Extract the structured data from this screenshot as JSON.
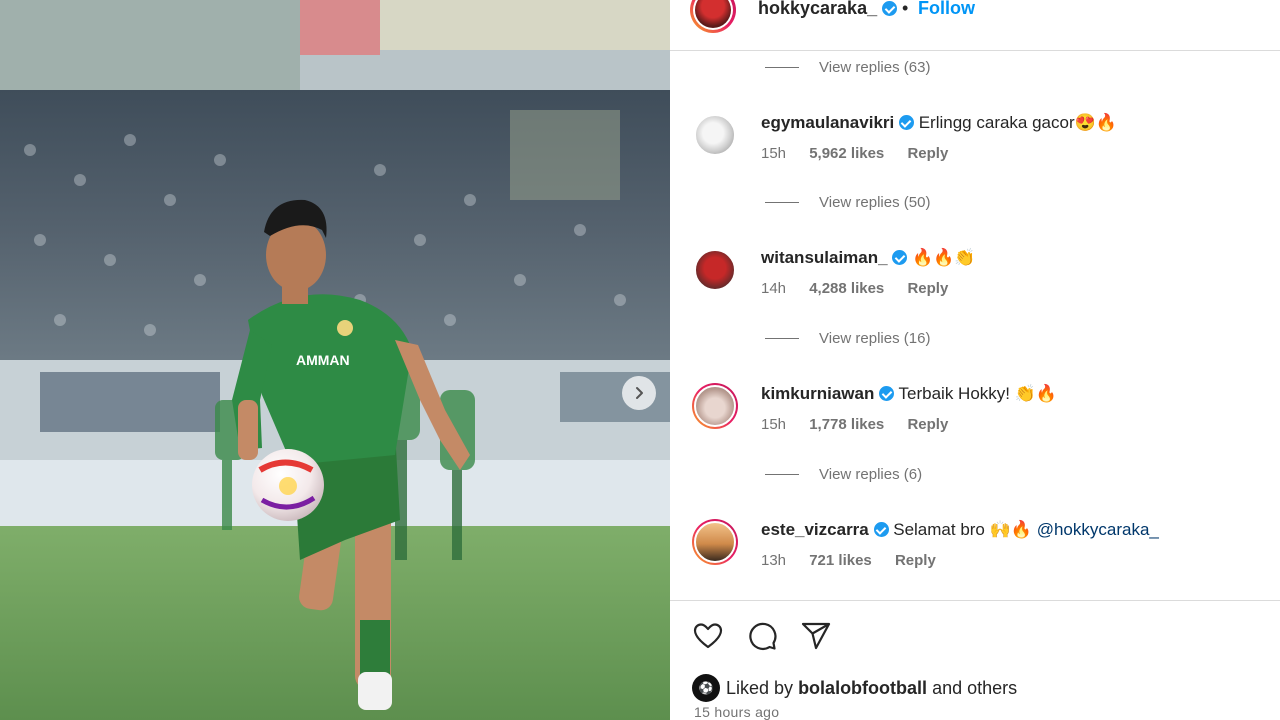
{
  "post": {
    "author": "hokkycaraka_",
    "separator": "•",
    "follow_label": "Follow",
    "liked_prefix": "Liked by",
    "liked_user": "bolalobfootball",
    "liked_suffix": "and others",
    "time_ago": "15 hours ago",
    "shirt_text": "AMMAN"
  },
  "comments": [
    {
      "view_replies_above": "View replies (63)",
      "username": "egymaulanavikri",
      "text": "Erlingg caraka gacor",
      "emojis": "😍🔥",
      "time": "15h",
      "likes": "5,962 likes",
      "reply": "Reply"
    },
    {
      "view_replies_above": "View replies (50)",
      "username": "witansulaiman_",
      "text": "",
      "emojis": "🔥🔥👏",
      "time": "14h",
      "likes": "4,288 likes",
      "reply": "Reply"
    },
    {
      "view_replies_above": "View replies (16)",
      "username": "kimkurniawan",
      "text": "Terbaik Hokky!",
      "emojis": "👏🔥",
      "time": "15h",
      "likes": "1,778 likes",
      "reply": "Reply"
    },
    {
      "view_replies_above": "View replies (6)",
      "username": "este_vizcarra",
      "text": "Selamat bro",
      "emojis": "🙌🔥",
      "mention": "@hokkycaraka_",
      "time": "13h",
      "likes": "721 likes",
      "reply": "Reply"
    }
  ],
  "icons": [
    "heart-icon",
    "comment-icon",
    "share-icon",
    "chevron-right-icon",
    "verified-icon"
  ],
  "colors": {
    "accent": "#0095f6",
    "verified": "#1d9bf0",
    "muted": "#737373",
    "jersey": "#2e7d3a"
  }
}
